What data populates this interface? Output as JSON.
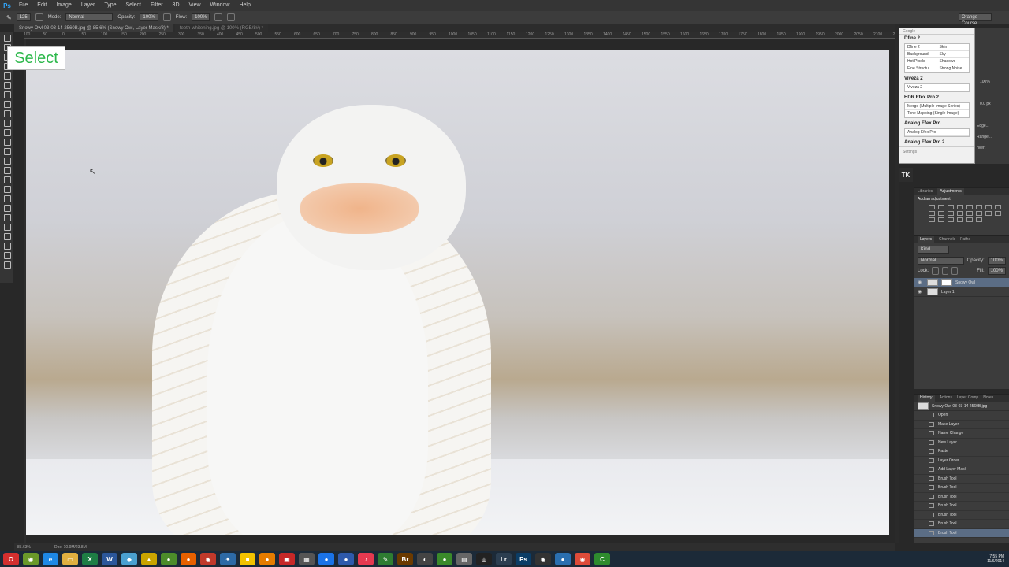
{
  "menu": {
    "logo": "Ps",
    "items": [
      "File",
      "Edit",
      "Image",
      "Layer",
      "Type",
      "Select",
      "Filter",
      "3D",
      "View",
      "Window",
      "Help"
    ]
  },
  "options": {
    "mode_label": "Mode:",
    "mode_value": "Normal",
    "opacity_label": "Opacity:",
    "opacity_value": "100%",
    "flow_label": "Flow:",
    "flow_value": "100%",
    "brush_size": "125",
    "workspace": "Orange Course"
  },
  "tabs": [
    {
      "label": "Snowy Owl 03-03-14 2560B.jpg @ 85.6% (Snowy Owl, Layer Mask/8) *"
    },
    {
      "label": "teeth-whitening.jpg @ 100% (RGB/8#) *"
    }
  ],
  "ruler_ticks": [
    "100",
    "50",
    "0",
    "50",
    "100",
    "150",
    "200",
    "250",
    "300",
    "350",
    "400",
    "450",
    "500",
    "550",
    "600",
    "650",
    "700",
    "750",
    "800",
    "850",
    "900",
    "950",
    "1000",
    "1050",
    "1100",
    "1150",
    "1200",
    "1250",
    "1300",
    "1350",
    "1400",
    "1450",
    "1500",
    "1550",
    "1600",
    "1650",
    "1700",
    "1750",
    "1800",
    "1850",
    "1900",
    "1950",
    "2000",
    "2050",
    "2100",
    "2150"
  ],
  "tooltip": "Select",
  "status": {
    "zoom": "85.63%",
    "doc": "Doc: 10.9M/23.8M"
  },
  "google_panel": {
    "header": "Google",
    "sections": [
      {
        "title": "Dfine 2",
        "cols": 2,
        "buttons": [
          "Dfine 2",
          "Skin",
          "Background",
          "Sky",
          "Hot Pixels",
          "Shadows",
          "Fine Structu...",
          "Strong Noise"
        ]
      },
      {
        "title": "Viveza 2",
        "cols": 1,
        "buttons": [
          "Viveza 2"
        ]
      },
      {
        "title": "HDR Efex Pro 2",
        "cols": 1,
        "buttons": [
          "Merge (Multiple Image Series)",
          "Tone Mapping (Single Image)"
        ]
      },
      {
        "title": "Analog Efex Pro",
        "cols": 1,
        "buttons": [
          "Analog Efex Pro"
        ]
      },
      {
        "title": "Analog Efex Pro 2",
        "cols": 1,
        "buttons": []
      }
    ],
    "settings": "Settings"
  },
  "right_mini": {
    "percent": "100%",
    "px": "0.0 px",
    "edge": "Edge...",
    "range": "Range...",
    "invert": "nvert"
  },
  "tk_label": "TK",
  "adjustments": {
    "tabs": [
      "Libraries",
      "Adjustments"
    ],
    "title": "Add an adjustment"
  },
  "layers": {
    "tabs": [
      "Layers",
      "Channels",
      "Paths"
    ],
    "kind": "Kind",
    "blend": "Normal",
    "opacity_label": "Opacity:",
    "opacity": "100%",
    "lock_label": "Lock:",
    "fill_label": "Fill:",
    "fill": "100%",
    "rows": [
      {
        "name": "Snowy Owl",
        "selected": true
      },
      {
        "name": "Layer 1",
        "selected": false
      }
    ]
  },
  "history": {
    "tabs": [
      "History",
      "Actions",
      "Layer Comp",
      "Notes"
    ],
    "snapshot": "Snowy Owl 03-03-14 2560B.jpg",
    "items": [
      "Open",
      "Make Layer",
      "Name Change",
      "New Layer",
      "Paste",
      "Layer Order",
      "Add Layer Mask",
      "Brush Tool",
      "Brush Tool",
      "Brush Tool",
      "Brush Tool",
      "Brush Tool",
      "Brush Tool",
      "Brush Tool"
    ]
  },
  "taskbar": {
    "apps": [
      {
        "name": "opera",
        "glyph": "O",
        "color": "#d32f2f"
      },
      {
        "name": "chrome-canary",
        "glyph": "◉",
        "color": "#6a9a2a"
      },
      {
        "name": "ie",
        "glyph": "e",
        "color": "#1e88e5"
      },
      {
        "name": "explorer",
        "glyph": "▭",
        "color": "#e0b040"
      },
      {
        "name": "excel",
        "glyph": "X",
        "color": "#1e7e45"
      },
      {
        "name": "word",
        "glyph": "W",
        "color": "#2b579a"
      },
      {
        "name": "app7",
        "glyph": "◆",
        "color": "#4aa0d0"
      },
      {
        "name": "app8",
        "glyph": "▲",
        "color": "#c9a400"
      },
      {
        "name": "app9",
        "glyph": "●",
        "color": "#4c8c2a"
      },
      {
        "name": "firefox",
        "glyph": "●",
        "color": "#e66000"
      },
      {
        "name": "app11",
        "glyph": "◉",
        "color": "#c0392b"
      },
      {
        "name": "app12",
        "glyph": "✦",
        "color": "#2d6aa6"
      },
      {
        "name": "app13",
        "glyph": "■",
        "color": "#f2c200"
      },
      {
        "name": "app14",
        "glyph": "●",
        "color": "#e57c00"
      },
      {
        "name": "app15",
        "glyph": "▣",
        "color": "#c62828"
      },
      {
        "name": "app16",
        "glyph": "▦",
        "color": "#555"
      },
      {
        "name": "app17",
        "glyph": "●",
        "color": "#1a73e8"
      },
      {
        "name": "app18",
        "glyph": "●",
        "color": "#2e5aac"
      },
      {
        "name": "itunes",
        "glyph": "♪",
        "color": "#e53950"
      },
      {
        "name": "app20",
        "glyph": "✎",
        "color": "#2e7d32"
      },
      {
        "name": "bridge",
        "glyph": "Br",
        "color": "#6b3a00"
      },
      {
        "name": "app22",
        "glyph": "◐",
        "color": "#444"
      },
      {
        "name": "app23",
        "glyph": "●",
        "color": "#3a8a2a"
      },
      {
        "name": "app24",
        "glyph": "▤",
        "color": "#666"
      },
      {
        "name": "app25",
        "glyph": "◎",
        "color": "#222"
      },
      {
        "name": "lightroom",
        "glyph": "Lr",
        "color": "#2c3e50"
      },
      {
        "name": "photoshop",
        "glyph": "Ps",
        "color": "#0b3d66"
      },
      {
        "name": "app28",
        "glyph": "◉",
        "color": "#333"
      },
      {
        "name": "app29",
        "glyph": "●",
        "color": "#2a6fb0"
      },
      {
        "name": "chrome",
        "glyph": "◉",
        "color": "#dd4b39"
      },
      {
        "name": "camtasia",
        "glyph": "C",
        "color": "#2e8b2e"
      }
    ],
    "time": "7:55 PM",
    "date": "11/6/2014"
  },
  "colors": {
    "accent": "#31a8ff",
    "selection": "#5b6d85",
    "tooltip_text": "#2db84b"
  }
}
